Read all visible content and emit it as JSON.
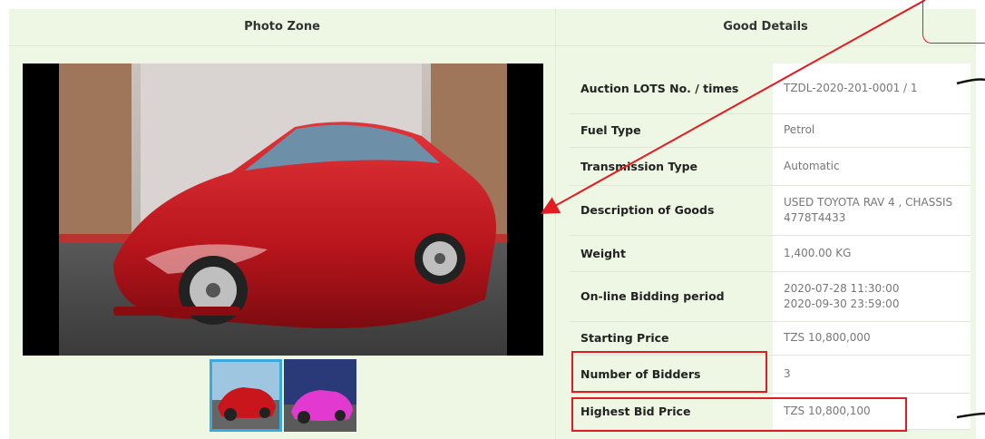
{
  "photo_zone": {
    "title": "Photo Zone",
    "thumbnails": [
      {
        "name": "red-car-thumbnail",
        "selected": true
      },
      {
        "name": "pink-car-thumbnail",
        "selected": false
      }
    ]
  },
  "good_details": {
    "title": "Good Details",
    "rows": [
      {
        "label": "Auction LOTS No. / times",
        "value": "TZDL-2020-201-0001 / 1"
      },
      {
        "label": "Fuel Type",
        "value": "Petrol"
      },
      {
        "label": "Transmission Type",
        "value": "Automatic"
      },
      {
        "label": "Description of Goods",
        "value": "USED TOYOTA RAV 4 , CHASSIS 4778T4433"
      },
      {
        "label": "Weight",
        "value": "1,400.00 KG"
      },
      {
        "label": "On-line Bidding period",
        "value": "2020-07-28 11:30:00",
        "value2": "2020-09-30 23:59:00"
      },
      {
        "label": "Starting Price",
        "value": "TZS 10,800,000"
      },
      {
        "label": "Number of Bidders",
        "value": "3"
      },
      {
        "label": "Highest Bid Price",
        "value": "TZS 10,800,100"
      }
    ]
  },
  "colors": {
    "panel_bg": "#eef7e3",
    "annotation_red": "#e21c23",
    "thumb_selected_border": "#3aa9e0"
  }
}
